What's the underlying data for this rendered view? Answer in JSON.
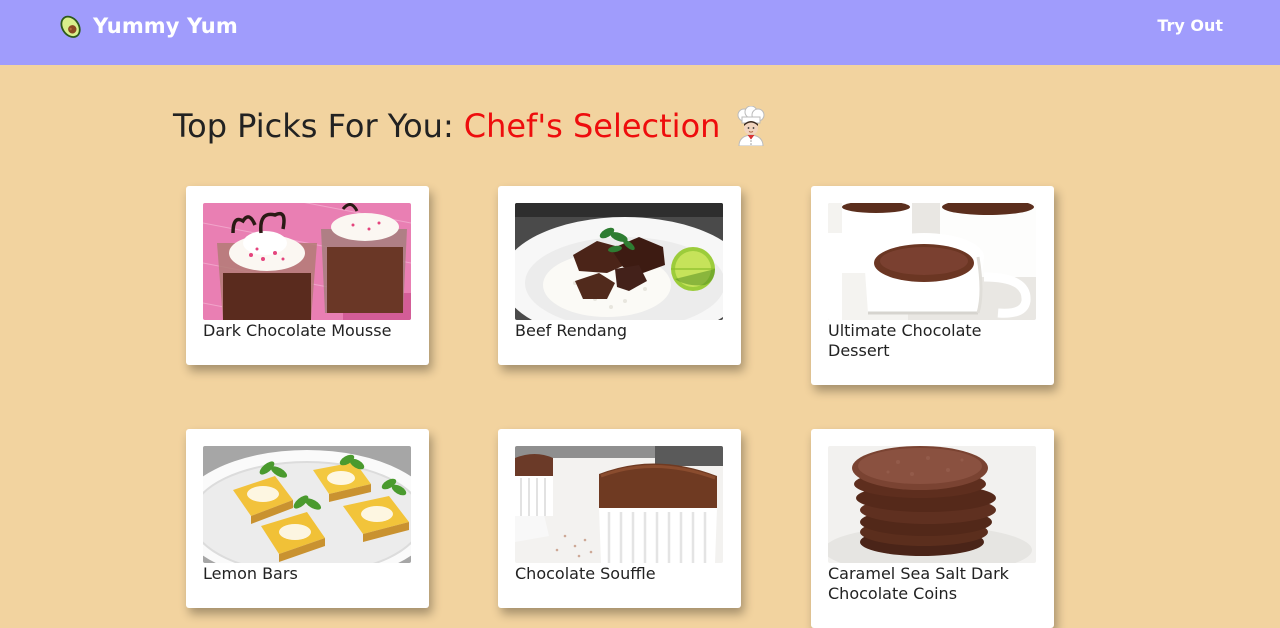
{
  "navbar": {
    "brand_icon": "avocado-icon",
    "brand_name": "Yummy Yum",
    "try_out_label": "Try Out",
    "background": "#a09cfc"
  },
  "heading": {
    "prefix": "Top Picks For You:",
    "accent": "Chef's Selection",
    "icon": "chef-icon",
    "accent_color": "#ee0d0d"
  },
  "recipes": [
    {
      "title": "Dark Chocolate Mousse",
      "image": "chocolate-mousse-image"
    },
    {
      "title": "Beef Rendang",
      "image": "beef-rendang-image"
    },
    {
      "title": "Ultimate Chocolate Dessert",
      "image": "hot-chocolate-image"
    },
    {
      "title": "Lemon Bars",
      "image": "lemon-bars-image"
    },
    {
      "title": "Chocolate Souffle",
      "image": "chocolate-souffle-image"
    },
    {
      "title": "Caramel Sea Salt Dark Chocolate Coins",
      "image": "chocolate-coins-image"
    }
  ],
  "colors": {
    "page_background": "#f2d39f",
    "card_background": "#ffffff"
  }
}
